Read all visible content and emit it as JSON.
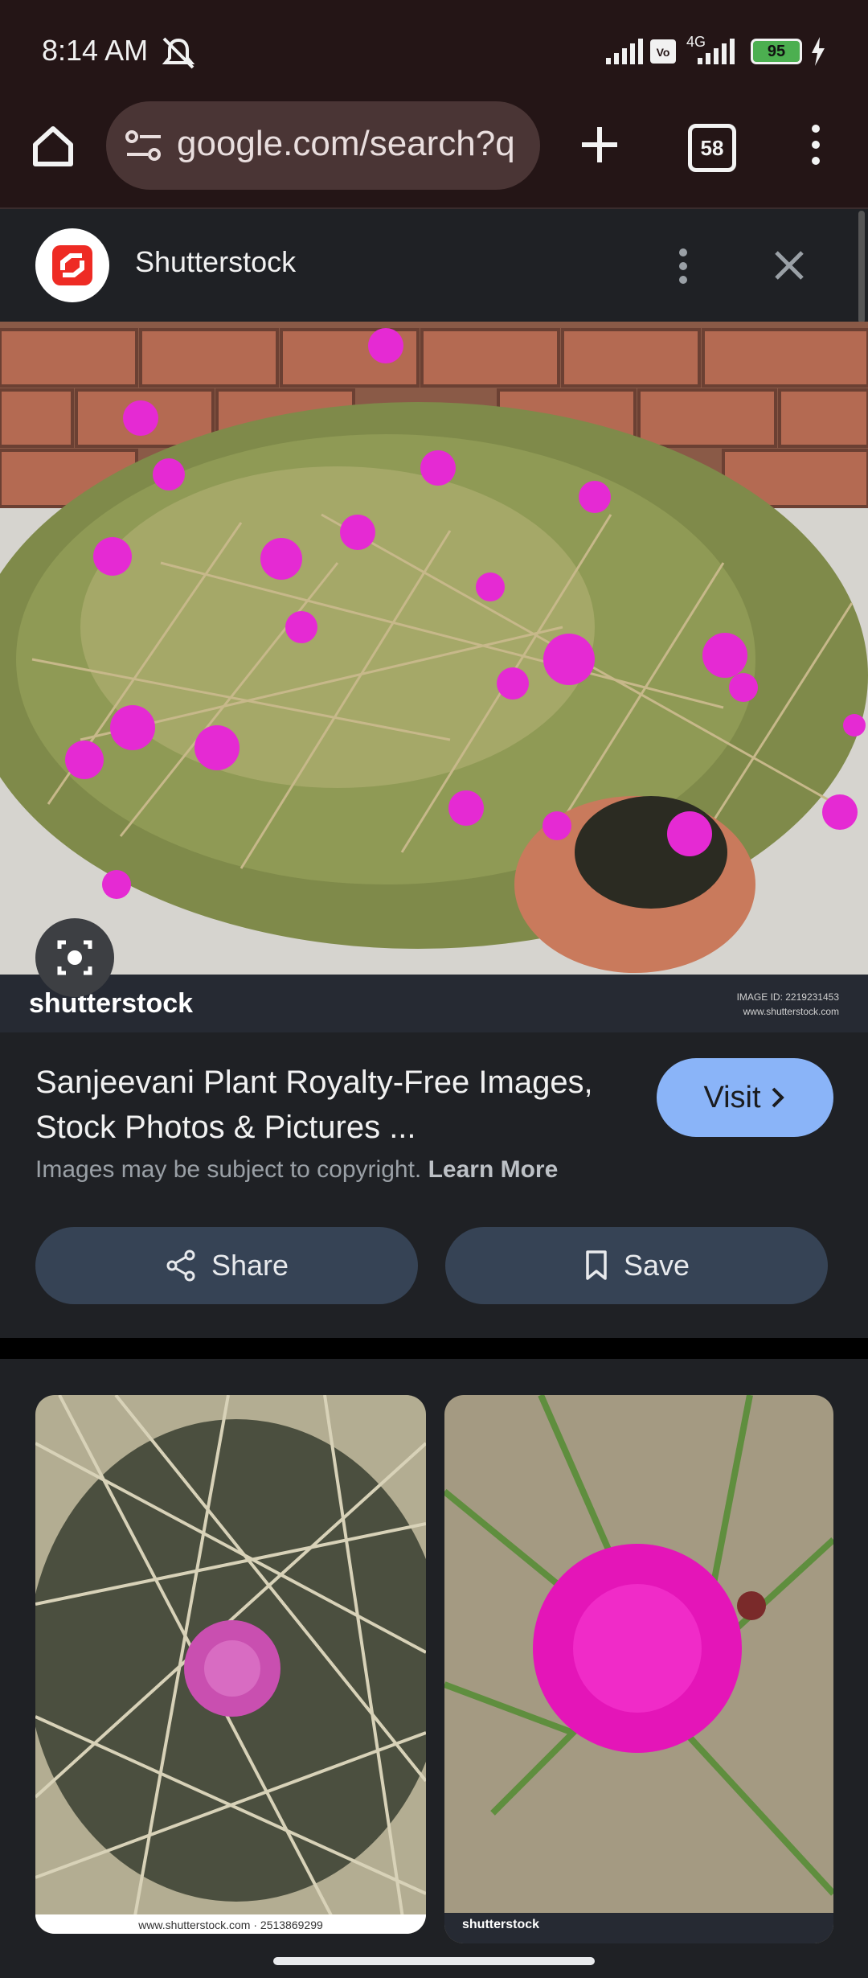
{
  "status_bar": {
    "time": "8:14 AM",
    "battery": "95",
    "network": "4G"
  },
  "browser": {
    "url": "google.com/search?q",
    "tab_count": "58"
  },
  "source": {
    "name": "Shutterstock"
  },
  "main_image": {
    "watermark": "shutterstock",
    "image_id": "IMAGE ID: 2219231453",
    "site": "www.shutterstock.com"
  },
  "result": {
    "title": "Sanjeevani Plant Royalty-Free Images, Stock Photos & Pictures ...",
    "copyright_text": "Images may be subject to copyright.",
    "learn_more": "Learn More",
    "visit_label": "Visit"
  },
  "actions": {
    "share_label": "Share",
    "save_label": "Save"
  },
  "related": [
    {
      "caption": "www.shutterstock.com · 2513869299"
    },
    {
      "caption": "shutterstock"
    }
  ],
  "colors": {
    "accent": "#8ab4f8",
    "pill": "#364355",
    "chrome": "#241516"
  }
}
